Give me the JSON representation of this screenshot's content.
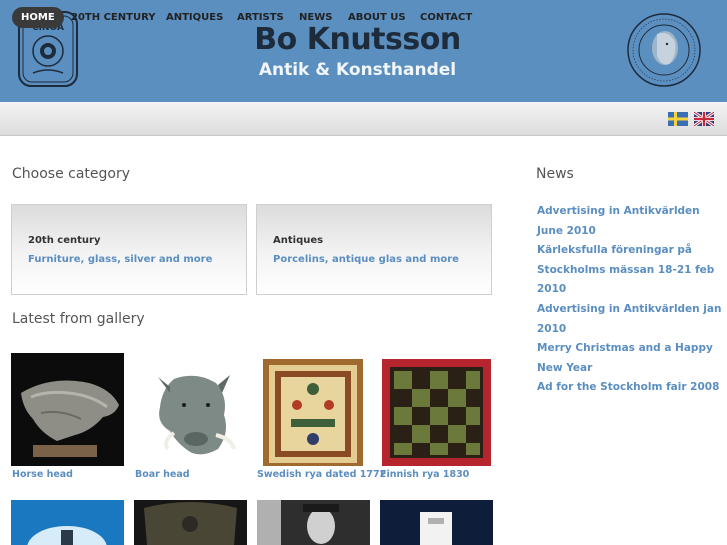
{
  "header": {
    "title": "Bo Knutsson",
    "subtitle": "Antik & Konsthandel",
    "left_logo_icon": "cinoa-logo",
    "left_logo_text": "CINOA",
    "right_logo_icon": "association-seal",
    "colors": {
      "header_bg": "#5a8fc0",
      "link": "#5b8ec0"
    }
  },
  "nav": {
    "items": [
      {
        "label": "HOME",
        "active": true
      },
      {
        "label": "20TH CENTURY"
      },
      {
        "label": "ANTIQUES"
      },
      {
        "label": "ARTISTS"
      },
      {
        "label": "NEWS"
      },
      {
        "label": "ABOUT US"
      },
      {
        "label": "CONTACT"
      }
    ],
    "flags": [
      "swedish-flag-icon",
      "uk-flag-icon"
    ]
  },
  "main": {
    "category_heading": "Choose category",
    "categories": [
      {
        "title": "20th century",
        "link": "Furniture, glass, silver and more"
      },
      {
        "title": "Antiques",
        "link": "Porcelins, antique glas and more"
      }
    ],
    "gallery_heading": "Latest from gallery",
    "gallery": [
      {
        "caption": "Horse head"
      },
      {
        "caption": "Boar head"
      },
      {
        "caption": "Swedish rya dated 1772"
      },
      {
        "caption": "Finnish rya 1830"
      }
    ]
  },
  "news": {
    "heading": "News",
    "items": [
      "Advertising in Antikvärlden June 2010",
      "Kärleksfulla föreningar på Stockholms mässan 18-21 feb 2010",
      "Advertising in Antikvärlden jan 2010",
      "Merry Christmas and a Happy New Year",
      "Ad for the Stockholm fair 2008"
    ]
  }
}
